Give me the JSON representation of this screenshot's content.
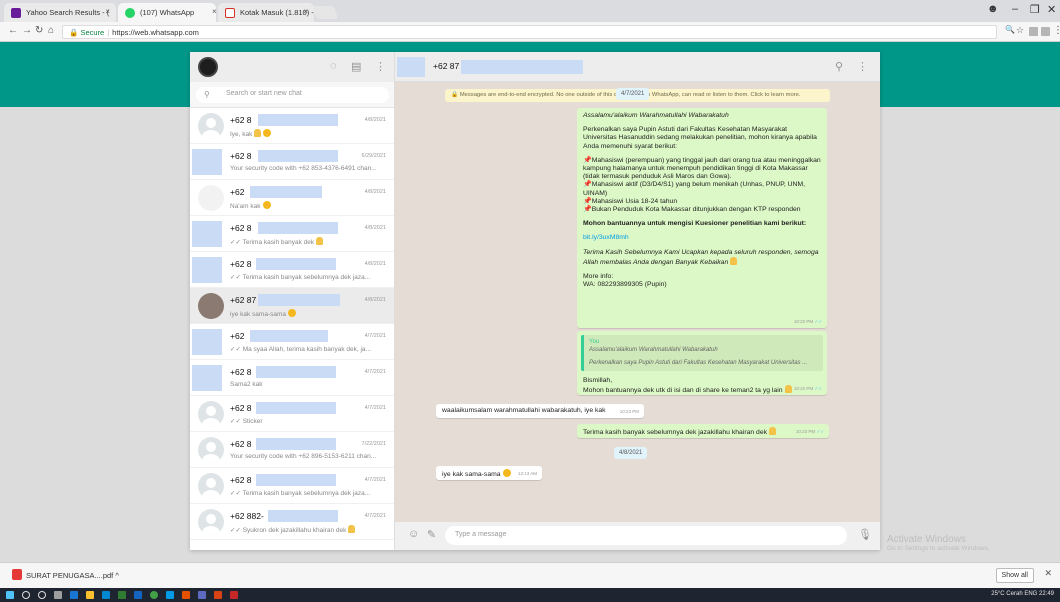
{
  "browser": {
    "tabs": [
      {
        "label": "Yahoo Search Results - (",
        "close": "×"
      },
      {
        "label": "(107) WhatsApp",
        "close": "×"
      },
      {
        "label": "Kotak Masuk (1.810) - p",
        "close": "×"
      }
    ],
    "secure_label": "Secure",
    "url": "https://web.whatsapp.com"
  },
  "whatsapp": {
    "search_placeholder": "Search or start new chat",
    "active_chat_name": "+62 87",
    "chats": [
      {
        "name": "+62 8",
        "preview": "Iye, kak",
        "time": "4/8/2021"
      },
      {
        "name": "+62 8",
        "preview": "Your security code with +62 853-4376-6491 chan...",
        "time": "6/29/2021"
      },
      {
        "name": "+62",
        "preview": "Na'am kak",
        "time": "4/8/2021"
      },
      {
        "name": "+62 8",
        "preview": "✓✓ Terima kasih banyak dek",
        "time": "4/8/2021"
      },
      {
        "name": "+62 8",
        "preview": "✓✓ Terima kasih banyak sebelumnya dek  jaza...",
        "time": "4/8/2021"
      },
      {
        "name": "+62 87",
        "preview": "iye kak sama-sama",
        "time": "4/8/2021"
      },
      {
        "name": "+62",
        "preview": "✓✓ Ma syaa Allah, terima kasih banyak dek,  ja...",
        "time": "4/7/2021"
      },
      {
        "name": "+62 8",
        "preview": "Sama2 kak",
        "time": "4/7/2021"
      },
      {
        "name": "+62 8",
        "preview": "✓✓ Sticker",
        "time": "4/7/2021"
      },
      {
        "name": "+62 8",
        "preview": "Your security code with +62 896-5153-6211 chan...",
        "time": "7/22/2021"
      },
      {
        "name": "+62 8",
        "preview": "✓✓ Terima kasih banyak sebelumnya dek  jaza...",
        "time": "4/7/2021"
      },
      {
        "name": "+62 882-",
        "preview": "✓✓ Syukron dek  jazakillahu khairan dek",
        "time": "4/7/2021"
      }
    ],
    "encryption_notice": "Messages are end-to-end encrypted. No one outside of this chat, not even WhatsApp, can read or listen to them. Click to learn more.",
    "date_1": "4/7/2021",
    "date_2": "4/8/2021",
    "msg1": {
      "greeting": "Assalamu'alaikum Warahmatullahi Wabarakatuh",
      "intro": "Perkenalkan saya Pupin Astuti dari Fakultas Kesehatan Masyarakat Universitas Hasanuddin sedang melakukan penelitian, mohon kiranya apabila Anda memenuhi syarat berikut:",
      "req1": "Mahasiswi (perempuan) yang tinggal jauh dari orang tua atau meninggalkan kampung halamanya untuk menempuh pendidikan tinggi di Kota Makassar (tidak termasuk penduduk Asli Maros dan Gowa).",
      "req2": "Mahasiswi aktif (D3/D4/S1) yang belum menikah (Unhas, PNUP, UNM, UINAM)",
      "req3": "Mahasiswi Usia 18-24 tahun",
      "req4": "Bukan Penduduk Kota Makassar ditunjukkan dengan KTP responden",
      "cta": "Mohon bantuannya untuk mengisi Kuesioner penelitian kami berikut:",
      "link": "bit.ly/3uxM8mh",
      "thanks": "Terima Kasih Sebelumnya Kami Ucapkan kepada seluruh responden, semoga Allah membalas Anda dengan Banyak Kebaikan",
      "more_info": "More info:",
      "wa": "WA: 082293899305 (Pupin)",
      "time": "10:22 PM"
    },
    "msg2": {
      "quote_author": "You",
      "quote_line1": "Assalamu'alaikum Warahmatullahi Wabarakatuh",
      "quote_line2": "Perkenalkan saya Pupin Astuti dari Fakultas Kesehatan Masyarakat Universitas ...",
      "line1": "Bismillah,",
      "line2": "Mohon bantuannya dek utk di isi dan di share ke teman2 ta yg lain",
      "time": "10:22 PM"
    },
    "msg3": {
      "text": "waalaikumsalam warahmatullahi wabarakatuh, iye kak",
      "time": "10:23 PM"
    },
    "msg4": {
      "text": "Terima kasih banyak sebelumnya dek  jazakillahu khairan dek",
      "time": "10:23 PM"
    },
    "msg5": {
      "text": "iye kak sama-sama",
      "time": "12:13 AM"
    },
    "compose_placeholder": "Type a message"
  },
  "windows_watermark": {
    "line1": "Activate Windows",
    "line2": "Go to Settings to activate Windows."
  },
  "download": {
    "filename": "SURAT PENUGASA....pdf",
    "show_all": "Show all"
  },
  "taskbar": {
    "tray": "25°C Cerah  ENG  22:49"
  }
}
